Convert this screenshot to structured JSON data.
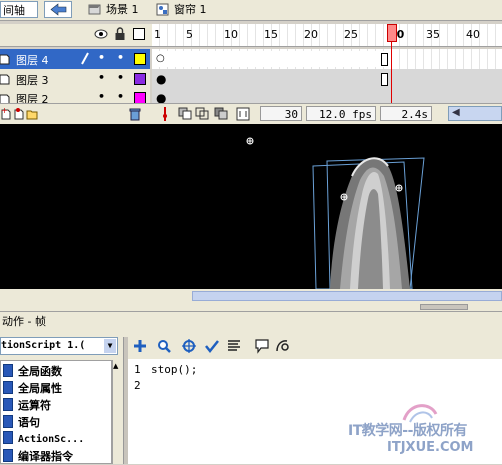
{
  "toolbar": {
    "timeline_label": "间轴",
    "scene_label": "场景 1",
    "symbol_label": "窗帘 1"
  },
  "timeline": {
    "frame_numbers": [
      "1",
      "5",
      "10",
      "15",
      "20",
      "25",
      "30",
      "35",
      "40"
    ],
    "layers": [
      {
        "name": "图层 4",
        "selected": true,
        "color": "#ffff00"
      },
      {
        "name": "图层 3",
        "selected": false,
        "color": "#8a2be2"
      },
      {
        "name": "图层 2",
        "selected": false,
        "color": "#ff00ff"
      }
    ],
    "current_frame": "30",
    "fps": "12.0 fps",
    "elapsed": "2.4s"
  },
  "actions": {
    "panel_title": "动作 - 帧",
    "script_version": "tionScript 1.(",
    "tree_items": [
      "全局函数",
      "全局属性",
      "运算符",
      "语句",
      "ActionSc...",
      "编译器指令"
    ],
    "line_numbers": [
      "1",
      "2"
    ],
    "code_lines": [
      "stop();",
      ""
    ]
  },
  "watermark": {
    "line1": "IT教学网--版权所有",
    "line2": "ITJXUE.COM"
  },
  "colors": {
    "selected_layer": "#3168c6",
    "playhead": "#ff6a6a",
    "panel_bg": "#ece9d8",
    "stage_bg": "#000000"
  }
}
